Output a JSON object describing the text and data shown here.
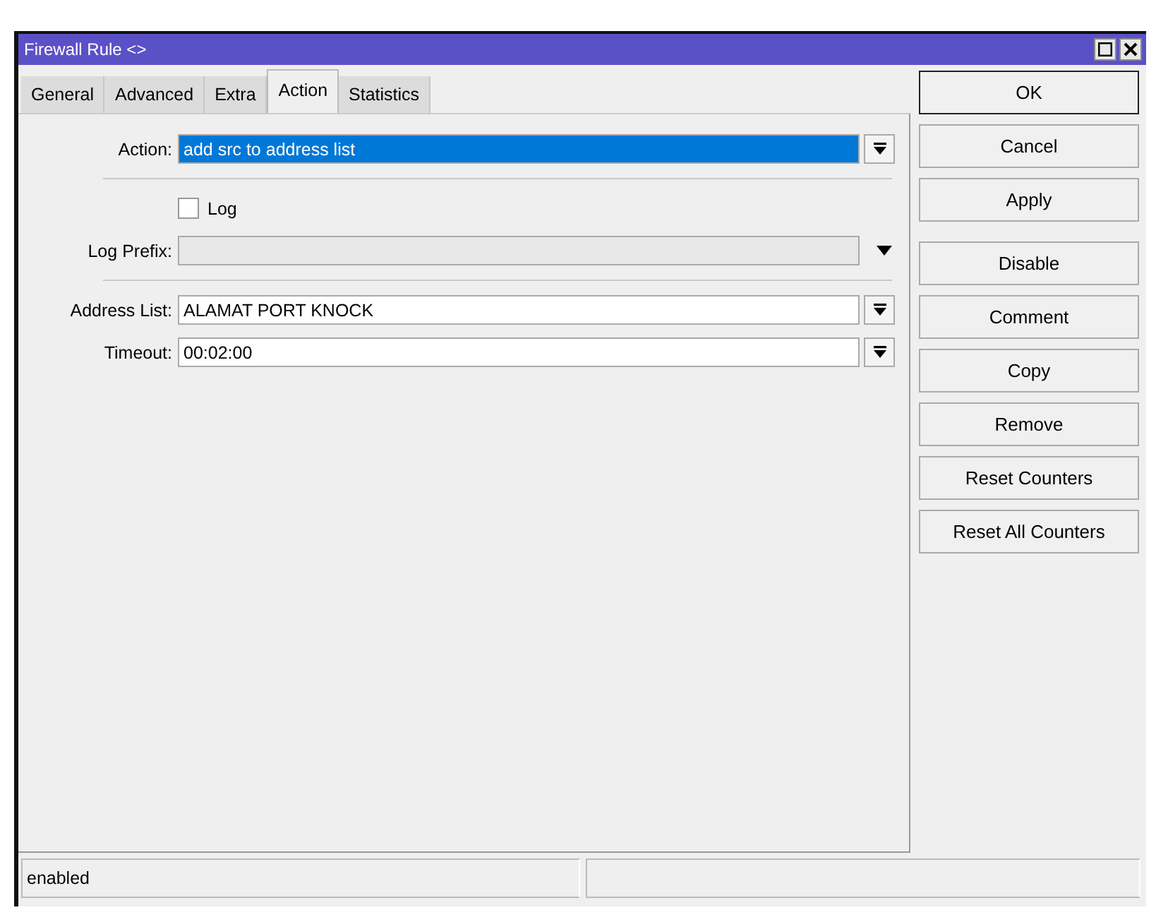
{
  "window": {
    "title": "Firewall Rule <>"
  },
  "tabs": [
    {
      "label": "General",
      "selected": false
    },
    {
      "label": "Advanced",
      "selected": false
    },
    {
      "label": "Extra",
      "selected": false
    },
    {
      "label": "Action",
      "selected": true
    },
    {
      "label": "Statistics",
      "selected": false
    }
  ],
  "sections": [
    {
      "rows": [
        {
          "kind": "select",
          "label": "Action:",
          "value": "add src to address list",
          "highlighted": true
        }
      ]
    },
    {
      "rows": [
        {
          "kind": "checkbox",
          "label": "Log",
          "checked": false
        },
        {
          "kind": "combo",
          "label": "Log Prefix:"
        }
      ]
    },
    {
      "rows": [
        {
          "kind": "select",
          "label": "Address List:",
          "value": "ALAMAT PORT KNOCK",
          "highlighted": false
        },
        {
          "kind": "select",
          "label": "Timeout:",
          "value": "00:02:00",
          "highlighted": false
        }
      ]
    }
  ],
  "button_groups": [
    [
      {
        "label": "OK",
        "default": true
      },
      {
        "label": "Cancel",
        "default": false
      },
      {
        "label": "Apply",
        "default": false
      }
    ],
    [
      {
        "label": "Disable",
        "default": false
      },
      {
        "label": "Comment",
        "default": false
      },
      {
        "label": "Copy",
        "default": false
      },
      {
        "label": "Remove",
        "default": false
      },
      {
        "label": "Reset Counters",
        "default": false
      },
      {
        "label": "Reset All Counters",
        "default": false
      }
    ]
  ],
  "status_bar": [
    "enabled"
  ]
}
